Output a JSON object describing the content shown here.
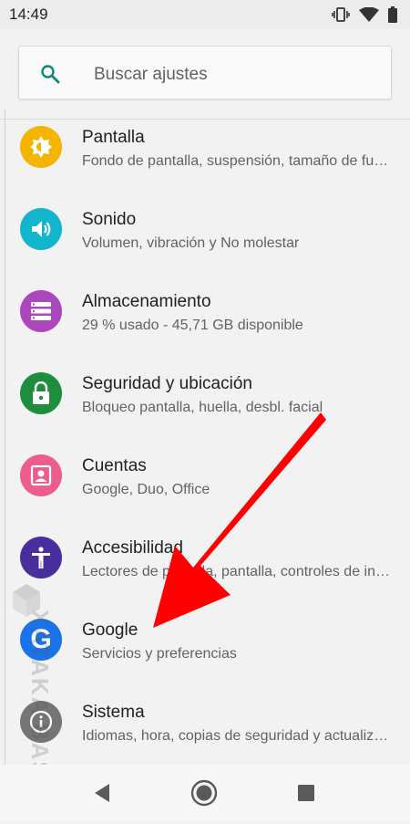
{
  "status_bar": {
    "time": "14:49"
  },
  "search": {
    "placeholder": "Buscar ajustes"
  },
  "settings": [
    {
      "title": "Pantalla",
      "subtitle": "Fondo de pantalla, suspensión, tamaño de fuente",
      "icon": "brightness-icon",
      "color": "#F4B400"
    },
    {
      "title": "Sonido",
      "subtitle": "Volumen, vibración y No molestar",
      "icon": "volume-icon",
      "color": "#12B5CB"
    },
    {
      "title": "Almacenamiento",
      "subtitle": "29 % usado - 45,71 GB disponible",
      "icon": "storage-icon",
      "color": "#AB47BC"
    },
    {
      "title": "Seguridad y ubicación",
      "subtitle": "Bloqueo pantalla, huella, desbl. facial",
      "icon": "lock-icon",
      "color": "#1E8E3E"
    },
    {
      "title": "Cuentas",
      "subtitle": "Google, Duo, Office",
      "icon": "account-icon",
      "color": "#EC5C8C"
    },
    {
      "title": "Accesibilidad",
      "subtitle": "Lectores de pantalla, pantalla, controles de interacción",
      "icon": "accessibility-icon",
      "color": "#4A2E9E"
    },
    {
      "title": "Google",
      "subtitle": "Servicios y preferencias",
      "icon": "google-icon",
      "color": "#1A73E8"
    },
    {
      "title": "Sistema",
      "subtitle": "Idiomas, hora, copias de seguridad y actualizaciones",
      "icon": "info-icon",
      "color": "#757575"
    }
  ],
  "watermark": "XATAKA BASICS",
  "accent_color": "#1A73E8",
  "arrow_color": "#FF0000"
}
